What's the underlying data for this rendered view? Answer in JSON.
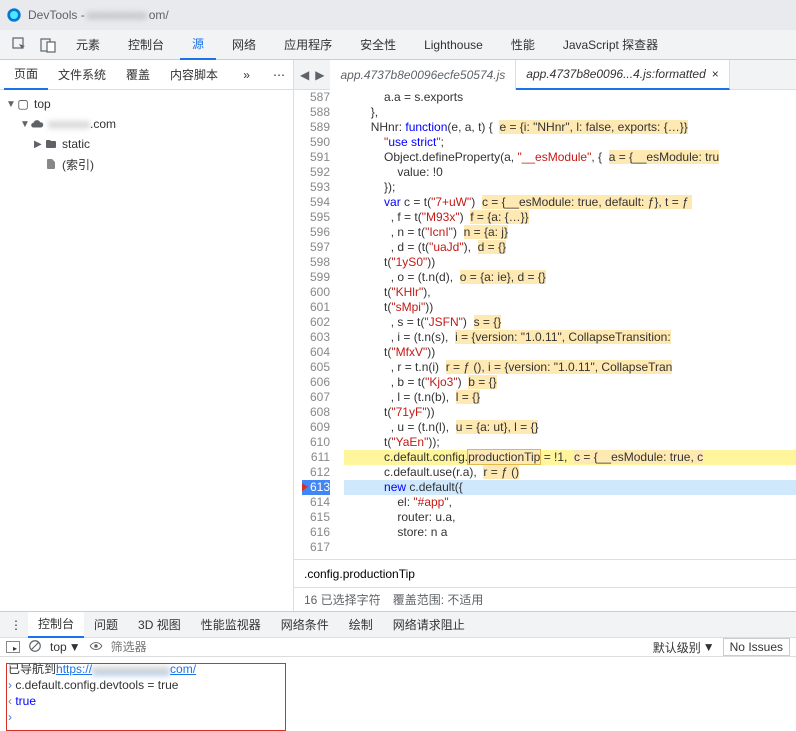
{
  "title": "DevTools - ",
  "title_domain_blur": "om/",
  "main_tabs": [
    "元素",
    "控制台",
    "源",
    "网络",
    "应用程序",
    "安全性",
    "Lighthouse",
    "性能",
    "JavaScript 探查器"
  ],
  "main_tab_active_index": 2,
  "left_subtabs": [
    "页面",
    "文件系统",
    "覆盖",
    "内容脚本"
  ],
  "left_subtab_active_index": 0,
  "tree": {
    "top": "top",
    "domain_blur": ".com",
    "static": "static",
    "index": "(索引)"
  },
  "file_tabs": [
    {
      "label": "app.4737b8e0096ecfe50574.js",
      "active": false
    },
    {
      "label": "app.4737b8e0096...4.js:formatted",
      "active": true
    }
  ],
  "gutter_start": 587,
  "code_lines": [
    {
      "n": 587,
      "t": "            a.a = s.exports"
    },
    {
      "n": 588,
      "t": "        },"
    },
    {
      "n": 589,
      "t": "        NHnr: function(e, a, t) {",
      "hl": "e = {i: \"NHnr\", l: false, exports: {…}}"
    },
    {
      "n": 590,
      "t": "            \"use strict\";"
    },
    {
      "n": 591,
      "t": "            Object.defineProperty(a, \"__esModule\", {",
      "hl": "a = {__esModule: tru"
    },
    {
      "n": 592,
      "t": "                value: !0"
    },
    {
      "n": 593,
      "t": "            });"
    },
    {
      "n": 594,
      "t": "            var c = t(\"7+uW\")",
      "hl": "c = {__esModule: true, default: ƒ}, t = ƒ "
    },
    {
      "n": 595,
      "t": "              , f = t(\"M93x\")",
      "hl": "f = {a: {…}}"
    },
    {
      "n": 596,
      "t": "              , n = t(\"IcnI\")",
      "hl": "n = {a: j}"
    },
    {
      "n": 597,
      "t": "              , d = (t(\"uaJd\"),",
      "hl": "d = {}"
    },
    {
      "n": 598,
      "t": "            t(\"1yS0\"))"
    },
    {
      "n": 599,
      "t": "              , o = (t.n(d),",
      "hl": "o = {a: ie}, d = {}"
    },
    {
      "n": 600,
      "t": "            t(\"KHlr\"),"
    },
    {
      "n": 601,
      "t": "            t(\"sMpi\"))"
    },
    {
      "n": 602,
      "t": "              , s = t(\"JSFN\")",
      "hl": "s = {}"
    },
    {
      "n": 603,
      "t": "              , i = (t.n(s),",
      "hl": "i = {version: \"1.0.11\", CollapseTransition:"
    },
    {
      "n": 604,
      "t": "            t(\"MfxV\"))"
    },
    {
      "n": 605,
      "t": "              , r = t.n(i)",
      "hl": "r = ƒ (), i = {version: \"1.0.11\", CollapseTran"
    },
    {
      "n": 606,
      "t": "              , b = t(\"Kjo3\")",
      "hl": "b = {}"
    },
    {
      "n": 607,
      "t": "              , l = (t.n(b),",
      "hl": "l = {}"
    },
    {
      "n": 608,
      "t": "            t(\"71yF\"))"
    },
    {
      "n": 609,
      "t": "              , u = (t.n(l),",
      "hl": "u = {a: ut}, l = {}"
    },
    {
      "n": 610,
      "t": "            t(\"YaEn\"));"
    },
    {
      "n": 611,
      "t": "            c.default.config.productionTip = !1,",
      "hl": "c = {__esModule: true, c",
      "yellow": true,
      "box": "productionTip"
    },
    {
      "n": 612,
      "t": "            c.default.use(r.a),",
      "hl": "r = ƒ ()"
    },
    {
      "n": 613,
      "t": "            new c.default({",
      "exec": true
    },
    {
      "n": 614,
      "t": "                el: \"#app\","
    },
    {
      "n": 615,
      "t": "                router: u.a,"
    },
    {
      "n": 616,
      "t": "                store: n a"
    },
    {
      "n": 617,
      "t": ""
    }
  ],
  "findbar_value": ".config.productionTip",
  "status_left": "16 已选择字符",
  "status_right": "覆盖范围: 不适用",
  "drawer_tabs": [
    "控制台",
    "问题",
    "3D 视图",
    "性能监视器",
    "网络条件",
    "绘制",
    "网络请求阻止"
  ],
  "drawer_tab_active_index": 0,
  "drawer_toolbar": {
    "context": "top",
    "filter_placeholder": "筛选器",
    "level": "默认级别",
    "issues": "No Issues"
  },
  "console": {
    "nav_prefix": "已导航到",
    "nav_link_left": "https://",
    "nav_link_right": "com/",
    "input_line": "c.default.config.devtools = true",
    "result_line": "true"
  },
  "chart_data": null
}
